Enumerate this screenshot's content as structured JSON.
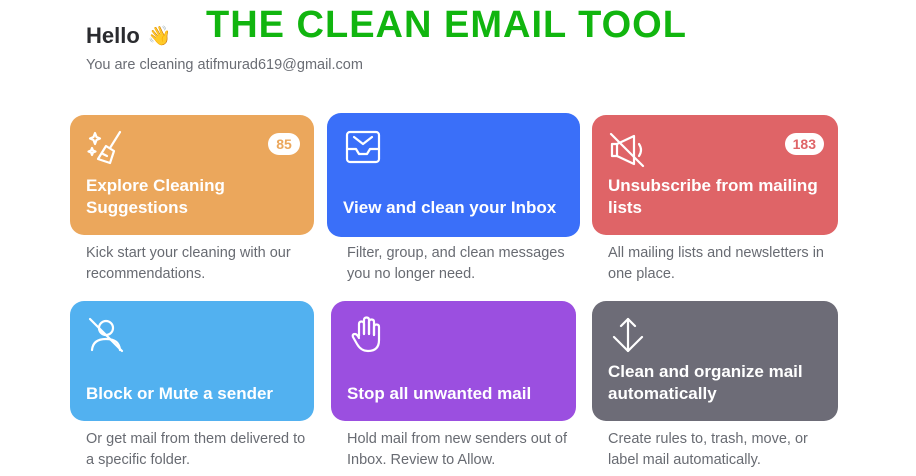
{
  "banner": {
    "text": "THE CLEAN EMAIL TOOL"
  },
  "header": {
    "greeting": "Hello",
    "wave_emoji": "👋",
    "subtitle": "You are cleaning atifmurad619@gmail.com"
  },
  "cards": [
    {
      "title": "Explore Cleaning Suggestions",
      "badge": "85",
      "description": "Kick start your cleaning with our recommendations.",
      "color": "#eba75c",
      "icon": "sparkles-broom-icon"
    },
    {
      "title": "View and clean your Inbox",
      "badge": "",
      "description": "Filter, group, and clean messages you no longer need.",
      "color": "#3a6ff9",
      "icon": "inbox-envelope-icon"
    },
    {
      "title": "Unsubscribe from mailing lists",
      "badge": "183",
      "description": "All mailing lists and newsletters in one place.",
      "color": "#df6467",
      "icon": "megaphone-off-icon"
    },
    {
      "title": "Block or Mute a sender",
      "badge": "",
      "description": "Or get mail from them delivered to a specific folder.",
      "color": "#52b1f0",
      "icon": "user-off-icon"
    },
    {
      "title": "Stop all unwanted mail",
      "badge": "",
      "description": "Hold mail from new senders out of Inbox. Review to Allow.",
      "color": "#9b4fe0",
      "icon": "hand-stop-icon"
    },
    {
      "title": "Clean and organize mail automatically",
      "badge": "",
      "description": "Create rules to, trash, move, or label mail automatically.",
      "color": "#6d6c77",
      "icon": "arrows-sort-icon"
    }
  ]
}
